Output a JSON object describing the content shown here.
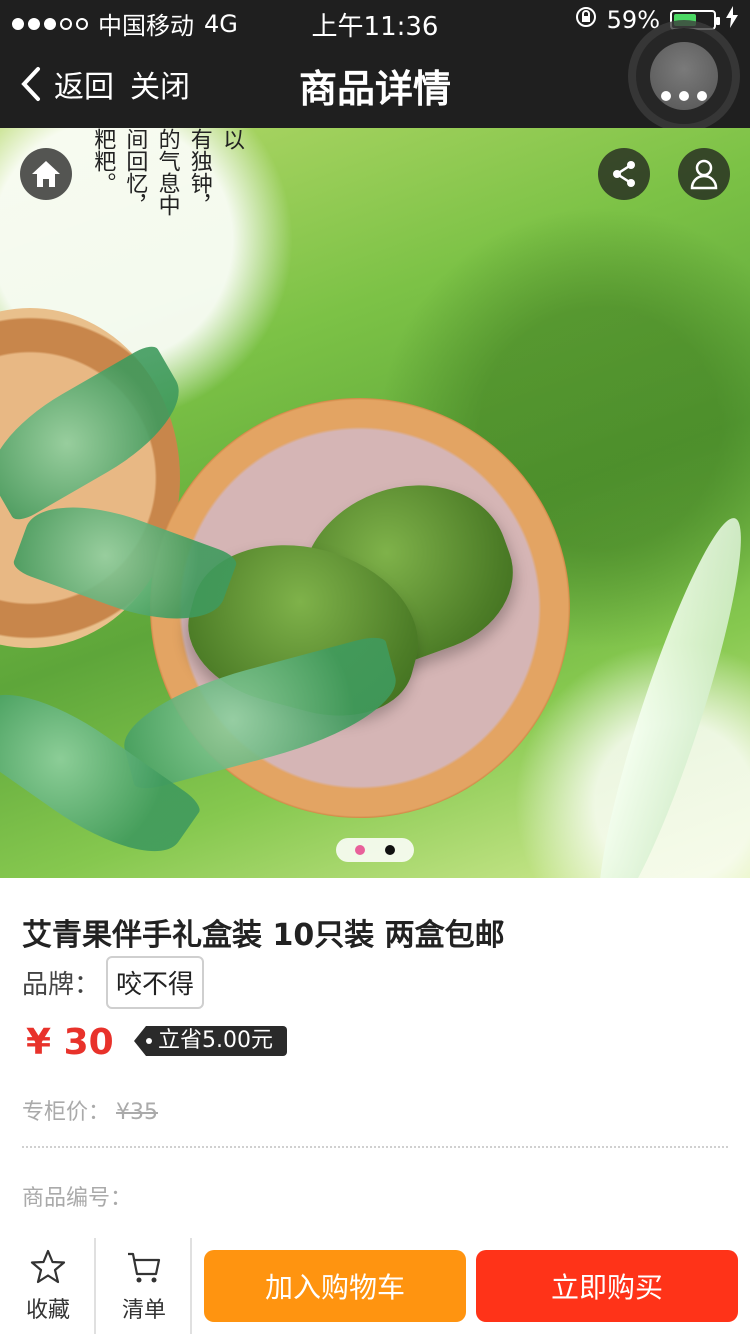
{
  "status_bar": {
    "carrier": "中国移动",
    "network": "4G",
    "time": "上午11:36",
    "battery_text": "59%",
    "battery_level": 0.59,
    "signal_bars": 3
  },
  "nav": {
    "back_label": "返回",
    "close_label": "关闭",
    "title": "商品详情"
  },
  "hero": {
    "poem_cols": [
      "以",
      "有独钟，",
      "的气息中",
      "间回忆，",
      "粑粑。"
    ],
    "carousel_count": 2,
    "carousel_active": 1,
    "colors": {
      "active_dot": "#e8609a",
      "inactive_dot": "#111111"
    }
  },
  "product": {
    "title": "艾青果伴手礼盒装 10只装 两盒包邮",
    "brand_label": "品牌：",
    "brand_value": "咬不得",
    "price": "¥ 30",
    "save_tag": "立省5.00元",
    "orig_label": "专柜价：",
    "orig_price": "¥35",
    "code_label": "商品编号："
  },
  "bottom_bar": {
    "favorite_label": "收藏",
    "list_label": "清单",
    "add_to_cart_label": "加入购物车",
    "buy_now_label": "立即购买",
    "colors": {
      "cart": "#ff9410",
      "buy": "#ff3318"
    }
  }
}
